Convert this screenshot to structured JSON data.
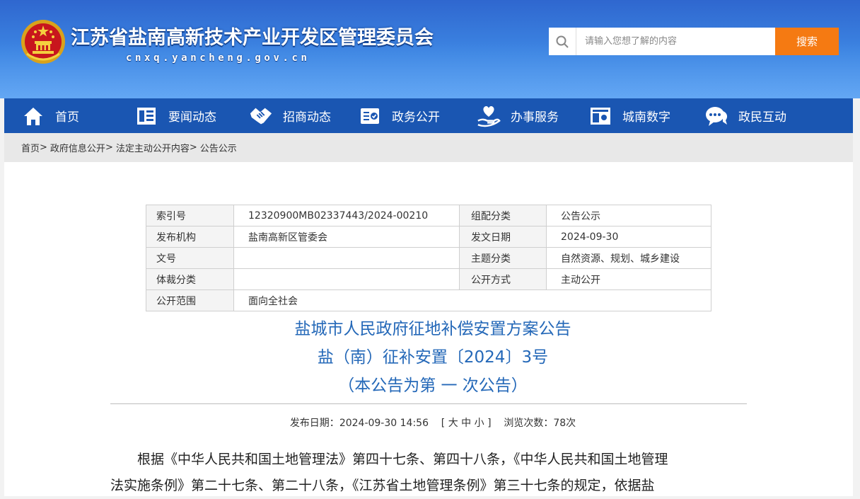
{
  "header": {
    "site_title": "江苏省盐南高新技术产业开发区管理委员会",
    "site_domain": "cnxq.yancheng.gov.cn",
    "search": {
      "placeholder": "请输入您想了解的内容",
      "button_label": "搜索"
    }
  },
  "nav": {
    "items": [
      {
        "label": "首页",
        "icon": "home-icon"
      },
      {
        "label": "要闻动态",
        "icon": "news-icon"
      },
      {
        "label": "招商动态",
        "icon": "handshake-icon"
      },
      {
        "label": "政务公开",
        "icon": "document-check-icon"
      },
      {
        "label": "办事服务",
        "icon": "hand-heart-icon"
      },
      {
        "label": "城南数字",
        "icon": "digital-screen-icon"
      },
      {
        "label": "政民互动",
        "icon": "chat-icon"
      }
    ]
  },
  "breadcrumb": [
    "首页",
    "政府信息公开",
    "法定主动公开内容",
    "公告公示"
  ],
  "breadcrumb_separator": ">",
  "meta": {
    "rows": [
      {
        "k1": "索引号",
        "v1": "12320900MB02337443/2024-00210",
        "k2": "组配分类",
        "v2": "公告公示"
      },
      {
        "k1": "发布机构",
        "v1": "盐南高新区管委会",
        "k2": "发文日期",
        "v2": "2024-09-30"
      },
      {
        "k1": "文号",
        "v1": "",
        "k2": "主题分类",
        "v2": "自然资源、规划、城乡建设"
      },
      {
        "k1": "体裁分类",
        "v1": "",
        "k2": "公开方式",
        "v2": "主动公开"
      }
    ],
    "scope_label": "公开范围",
    "scope_value": "面向全社会"
  },
  "document": {
    "title_line1": "盐城市人民政府征地补偿安置方案公告",
    "title_line2": "盐（南）征补安置〔2024〕3号",
    "title_line3": "（本公告为第 一 次公告）",
    "publish_label": "发布日期：",
    "publish_date": "2024-09-30 14:56",
    "font_size_label": "[ 大 中 小 ]",
    "font_large": "大",
    "font_medium": "中",
    "font_small": "小",
    "views_label": "浏览次数：",
    "views_count": "78次",
    "body_line1": "根据《中华人民共和国土地管理法》第四十七条、第四十八条，《中华人民共和国土地管理",
    "body_line2": "法实施条例》第二十七条、第二十八条，《江苏省土地管理条例》第三十七条的规定，依据盐"
  },
  "colors": {
    "header_blue": "#3d86e3",
    "nav_blue": "#1a56b2",
    "search_orange": "#f57a12",
    "title_blue": "#2468b8"
  }
}
